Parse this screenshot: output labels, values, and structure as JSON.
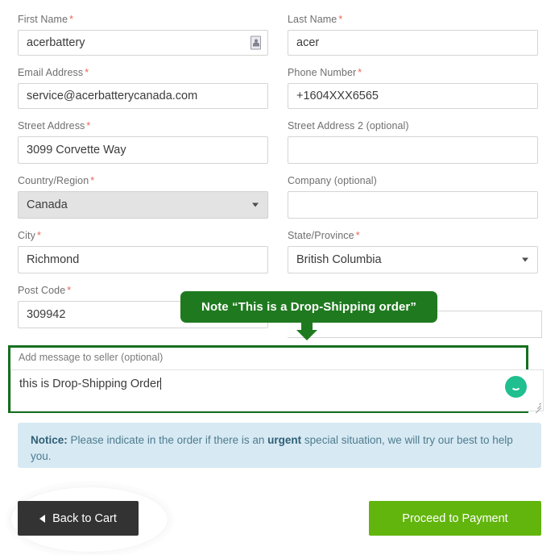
{
  "form": {
    "rows": [
      [
        {
          "name": "first-name",
          "label": "First Name",
          "required": true,
          "type": "text",
          "value": "acerbattery",
          "placeholder": "",
          "icon": "autofill-contact-icon"
        },
        {
          "name": "last-name",
          "label": "Last Name",
          "required": true,
          "type": "text",
          "value": "acer",
          "placeholder": ""
        }
      ],
      [
        {
          "name": "email-address",
          "label": "Email Address",
          "required": true,
          "type": "text",
          "value": "service@acerbatterycanada.com",
          "placeholder": ""
        },
        {
          "name": "phone-number",
          "label": "Phone Number",
          "required": true,
          "type": "text",
          "value": "+1604XXX6565",
          "placeholder": ""
        }
      ],
      [
        {
          "name": "street-address",
          "label": "Street Address",
          "required": true,
          "type": "text",
          "value": "3099 Corvette Way",
          "placeholder": ""
        },
        {
          "name": "street-address-2",
          "label": "Street Address 2 (optional)",
          "required": false,
          "type": "text",
          "value": "",
          "placeholder": ""
        }
      ],
      [
        {
          "name": "country-region",
          "label": "Country/Region",
          "required": true,
          "type": "select",
          "value": "Canada",
          "disabled": true
        },
        {
          "name": "company",
          "label": "Company (optional)",
          "required": false,
          "type": "text",
          "value": "",
          "placeholder": ""
        }
      ],
      [
        {
          "name": "city",
          "label": "City",
          "required": true,
          "type": "text",
          "value": "Richmond",
          "placeholder": ""
        },
        {
          "name": "state-province",
          "label": "State/Province",
          "required": true,
          "type": "select",
          "value": "British Columbia",
          "disabled": false
        }
      ],
      [
        {
          "name": "post-code",
          "label": "Post Code",
          "required": true,
          "type": "text",
          "value": "309942",
          "placeholder": ""
        }
      ]
    ]
  },
  "callout": {
    "text": "Note “This is a Drop-Shipping order”",
    "color": "#1f7a1f",
    "arrow": "down-arrow-icon"
  },
  "message": {
    "label": "Add message to seller (optional)",
    "value": "this is Drop-Shipping Order",
    "placeholder": "",
    "highlight_color": "#15701f"
  },
  "chat_widget": {
    "icon": "smiley-chat-icon",
    "color": "#1fbf8f"
  },
  "notice": {
    "prefix": "Notice:",
    "text_before": " Please indicate in the order if there is an ",
    "emphasis": "urgent",
    "text_after": " special situation, we will try our best to help you.",
    "background": "#d7eaf4"
  },
  "footer": {
    "back_label": "Back to Cart",
    "back_icon": "chevron-left-icon",
    "back_color": "#333333",
    "pay_label": "Proceed to Payment",
    "pay_color": "#62b50c"
  }
}
